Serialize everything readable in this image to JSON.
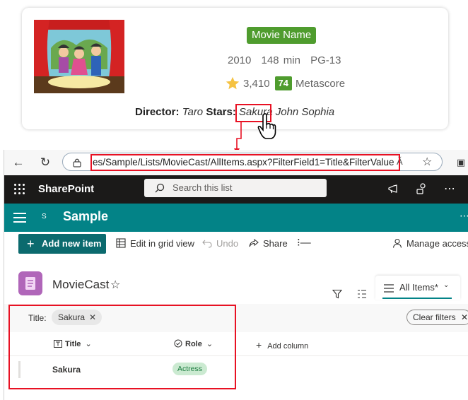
{
  "card": {
    "badge": "Movie Name",
    "year": "2010",
    "runtime": "148 min",
    "rating_code": "PG-13",
    "votes": "3,410",
    "metascore_value": "74",
    "metascore_label": "Metascore",
    "director_label": "Director:",
    "director": "Taro",
    "stars_label": "Stars:",
    "star_1": "Sakura",
    "stars_rest": "John Sophia"
  },
  "browser": {
    "url": "es/Sample/Lists/MovieCast/AllItems.aspx?FilterField1=Title&FilterValue1=Sakura",
    "read_aloud": "Ă"
  },
  "suitebar": {
    "brand": "SharePoint",
    "search_placeholder": "Search this list"
  },
  "site": {
    "logo_letter": "S",
    "name": "Sample"
  },
  "commands": {
    "new_item": "Add new item",
    "grid_view": "Edit in grid view",
    "undo": "Undo",
    "share": "Share",
    "manage_access": "Manage access"
  },
  "list": {
    "title": "MovieCast",
    "view": "All Items*"
  },
  "filter": {
    "label": "Title:",
    "value": "Sakura",
    "clear": "Clear filters"
  },
  "columns": {
    "title": "Title",
    "role": "Role",
    "add": "Add column"
  },
  "rows": [
    {
      "title": "Sakura",
      "role": "Actress"
    }
  ],
  "colors": {
    "accent": "#038387",
    "new_button": "#0b6a6e",
    "badge_green": "#4f9c2e",
    "highlight_red": "#e81123",
    "suite_bar": "#1b1a19"
  }
}
